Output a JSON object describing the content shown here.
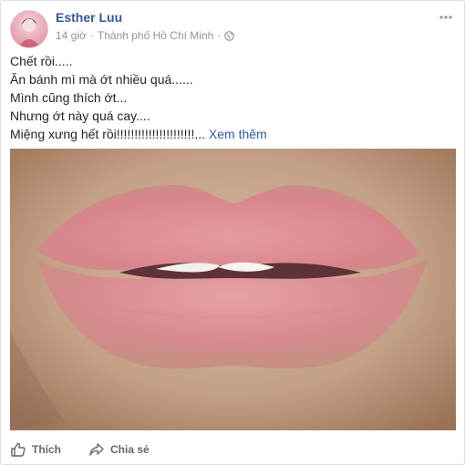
{
  "post": {
    "author": "Esther Luu",
    "time": "14 giờ",
    "location": "Thành phố Hồ Chí Minh",
    "privacy_icon": "globe-icon",
    "text_lines": [
      "Chết rồi.....",
      "Ăn bánh mì mà ớt nhiều quá......",
      "Mình cũng thích ớt...",
      "Nhưng ớt này quá cay....",
      "Miệng xưng hết rồi!!!!!!!!!!!!!!!!!!!!!!..."
    ],
    "see_more": "Xem thêm"
  },
  "actions": {
    "like_label": "Thích",
    "share_label": "Chia sẻ"
  },
  "colors": {
    "link": "#365899",
    "meta": "#90949c",
    "action": "#606770"
  }
}
